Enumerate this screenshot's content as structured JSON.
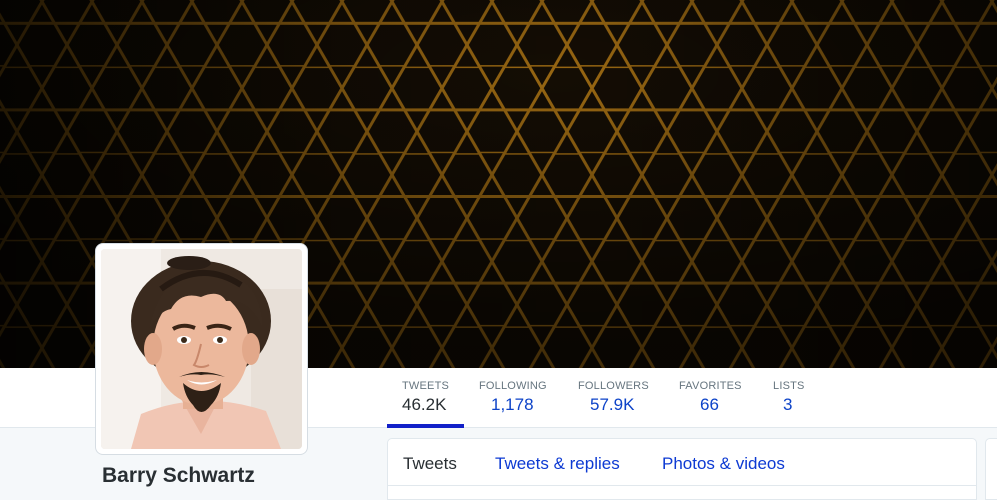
{
  "profile": {
    "name": "Barry Schwartz"
  },
  "stats": [
    {
      "label": "TWEETS",
      "value": "46.2K"
    },
    {
      "label": "FOLLOWING",
      "value": "1,178"
    },
    {
      "label": "FOLLOWERS",
      "value": "57.9K"
    },
    {
      "label": "FAVORITES",
      "value": "66"
    },
    {
      "label": "LISTS",
      "value": "3"
    }
  ],
  "timeline_tabs": [
    {
      "label": "Tweets"
    },
    {
      "label": "Tweets & replies"
    },
    {
      "label": "Photos & videos"
    }
  ],
  "colors": {
    "link": "#0d43c8",
    "active_tab_underline": "#1220c8",
    "banner_honeycomb": "#8a5a10"
  }
}
